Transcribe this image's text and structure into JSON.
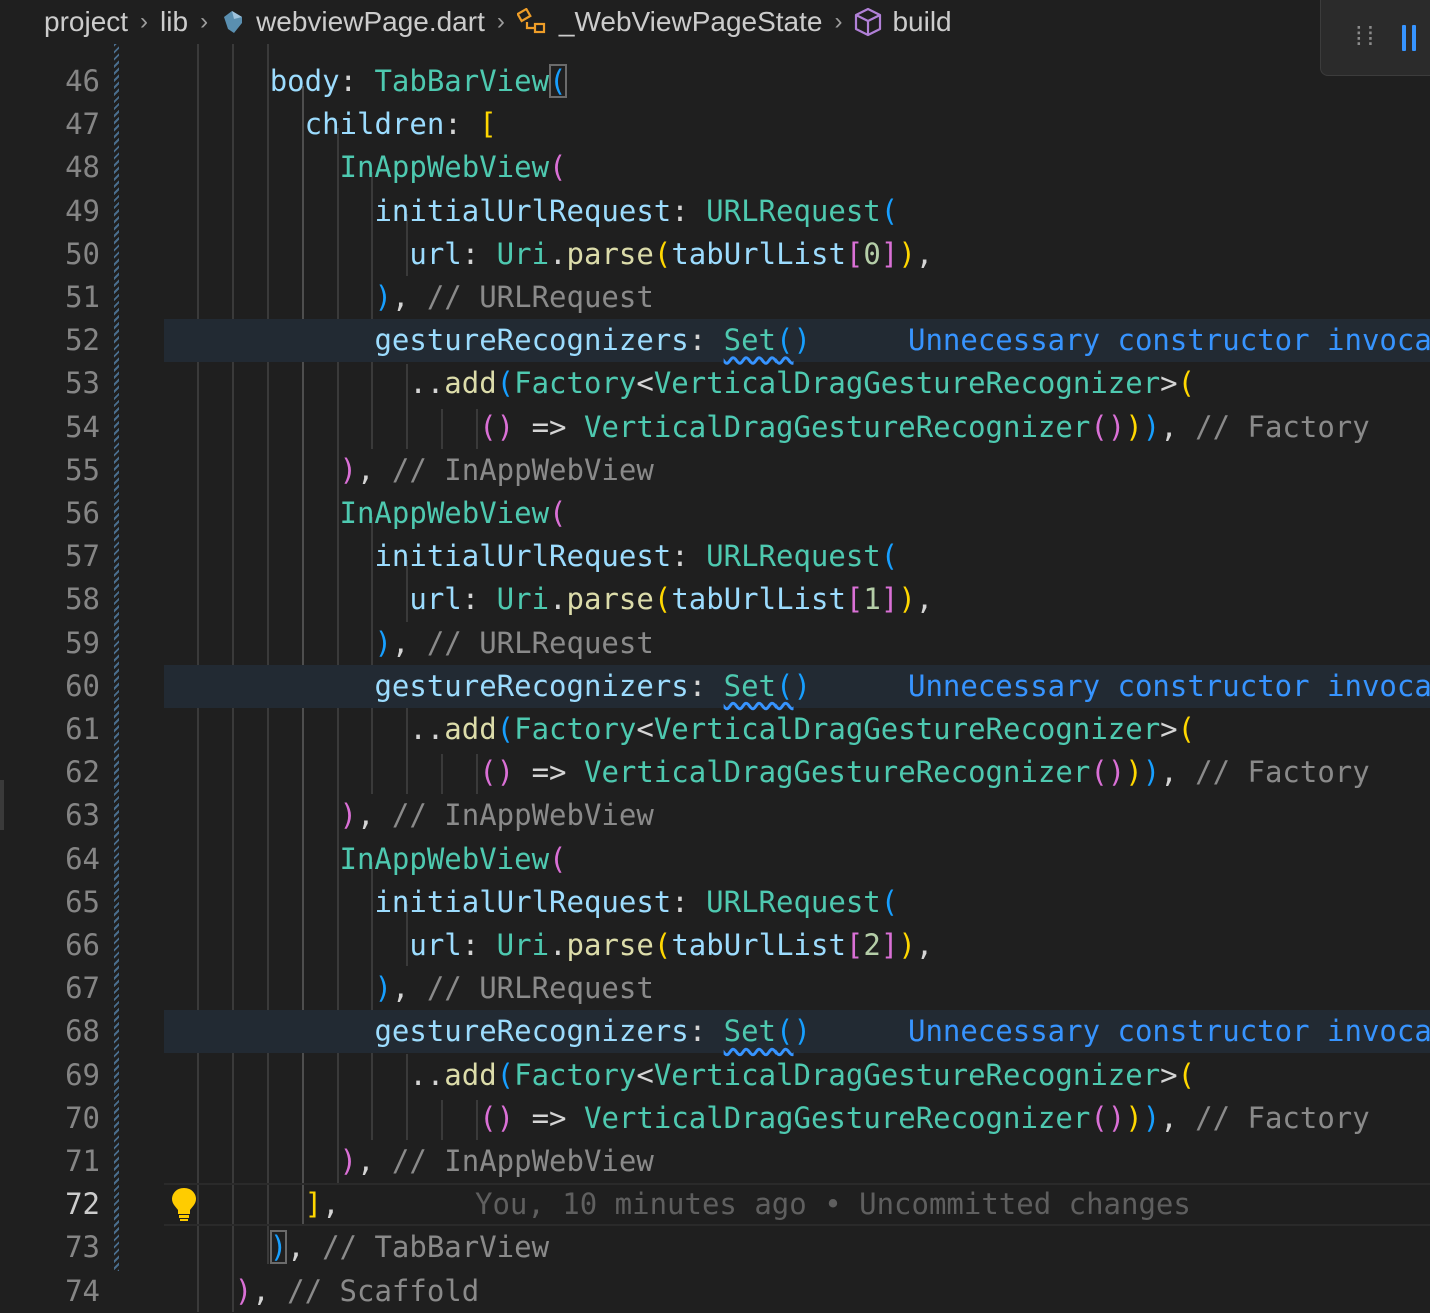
{
  "breadcrumb": {
    "items": [
      "project",
      "lib",
      "webviewPage.dart",
      "_WebViewPageState",
      "build"
    ],
    "icons": [
      "none",
      "none",
      "dart-file-icon",
      "class-icon",
      "method-cube-icon"
    ]
  },
  "toolbar": {
    "icons": [
      "drag-grip-icon",
      "pause-icon"
    ]
  },
  "editor": {
    "current_line": 72,
    "hint_message": "Unnecessary constructor invoca",
    "blame": "You, 10 minutes ago • Uncommitted changes",
    "lines": [
      {
        "n": "46",
        "text": "        body: TabBarView("
      },
      {
        "n": "47",
        "text": "          children: ["
      },
      {
        "n": "48",
        "text": "            InAppWebView("
      },
      {
        "n": "49",
        "text": "              initialUrlRequest: URLRequest("
      },
      {
        "n": "50",
        "text": "                url: Uri.parse(tabUrlList[0]),"
      },
      {
        "n": "51",
        "text": "              ), // URLRequest"
      },
      {
        "n": "52",
        "text": "              gestureRecognizers: Set()"
      },
      {
        "n": "53",
        "text": "                ..add(Factory<VerticalDragGestureRecognizer>("
      },
      {
        "n": "54",
        "text": "                    () => VerticalDragGestureRecognizer())), // Factory"
      },
      {
        "n": "55",
        "text": "            ), // InAppWebView"
      },
      {
        "n": "56",
        "text": "            InAppWebView("
      },
      {
        "n": "57",
        "text": "              initialUrlRequest: URLRequest("
      },
      {
        "n": "58",
        "text": "                url: Uri.parse(tabUrlList[1]),"
      },
      {
        "n": "59",
        "text": "              ), // URLRequest"
      },
      {
        "n": "60",
        "text": "              gestureRecognizers: Set()"
      },
      {
        "n": "61",
        "text": "                ..add(Factory<VerticalDragGestureRecognizer>("
      },
      {
        "n": "62",
        "text": "                    () => VerticalDragGestureRecognizer())), // Factory"
      },
      {
        "n": "63",
        "text": "            ), // InAppWebView"
      },
      {
        "n": "64",
        "text": "            InAppWebView("
      },
      {
        "n": "65",
        "text": "              initialUrlRequest: URLRequest("
      },
      {
        "n": "66",
        "text": "                url: Uri.parse(tabUrlList[2]),"
      },
      {
        "n": "67",
        "text": "              ), // URLRequest"
      },
      {
        "n": "68",
        "text": "              gestureRecognizers: Set()"
      },
      {
        "n": "69",
        "text": "                ..add(Factory<VerticalDragGestureRecognizer>("
      },
      {
        "n": "70",
        "text": "                    () => VerticalDragGestureRecognizer())), // Factory"
      },
      {
        "n": "71",
        "text": "            ), // InAppWebView"
      },
      {
        "n": "72",
        "text": "          ],"
      },
      {
        "n": "73",
        "text": "        ), // TabBarView"
      },
      {
        "n": "74",
        "text": "      ), // Scaffold"
      }
    ]
  },
  "colors": {
    "background": "#1f1f1f",
    "property": "#9cdcfe",
    "type": "#4ec9b0",
    "function": "#dcdcaa",
    "comment": "#8a8a8a",
    "bracket_gold": "#ffd700",
    "bracket_purple": "#da70d6",
    "bracket_blue": "#179fff",
    "hint": "#3794ff"
  }
}
